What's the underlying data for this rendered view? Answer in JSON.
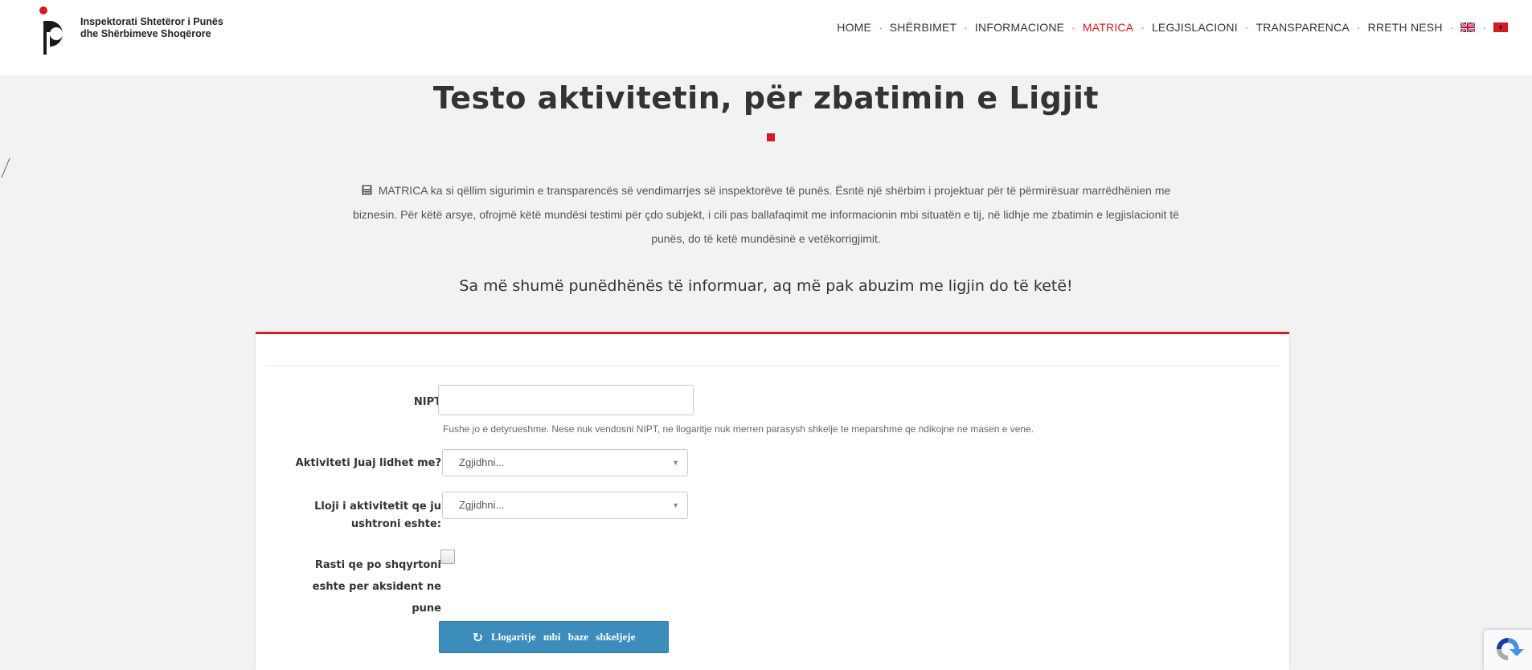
{
  "header": {
    "logo_line1": "Inspektorati Shtetëror i Punës",
    "logo_line2": "dhe Shërbimeve Shoqërore",
    "nav": [
      {
        "label": "HOME"
      },
      {
        "label": "SHËRBIMET"
      },
      {
        "label": "INFORMACIONE"
      },
      {
        "label": "MATRICA"
      },
      {
        "label": "LEGJISLACIONI"
      },
      {
        "label": "TRANSPARENCA"
      },
      {
        "label": "RRETH NESH"
      }
    ],
    "separator": "·",
    "active_item": "MATRICA",
    "icons": [
      "uk-flag-icon",
      "albania-flag-icon"
    ]
  },
  "main": {
    "title": "Testo aktivitetin, për zbatimin e Ligjit",
    "intro_line1": "MATRICA ka si qëllim sigurimin e transparencës së vendimarrjes së inspektorëve të punës. Ësntë një shërbim i projektuar për të përmirësuar marrëdhënien me",
    "intro_line2": "biznesin. Për këtë arsye, ofrojmë këtë mundësi testimi për çdo subjekt, i cili pas ballafaqimit me informacionin mbi situatën e tij, në lidhje me zbatimin e legjislacionit të",
    "intro_line3": "punës, do të ketë mundësinë e vetëkorrigjimit.",
    "tagline": "Sa më shumë punëdhënës të informuar, aq më pak abuzim me ligjin do të ketë!"
  },
  "form": {
    "nipt_label": "NIPT",
    "nipt_value": "",
    "nipt_help": "Fushe jo e detyrueshme. Nese nuk vendosni NIPT, ne llogaritje nuk merren parasysh shkelje te meparshme qe ndikojne ne masen e vene.",
    "activity_label": "Aktiviteti Juaj lidhet me?",
    "activity_selected": "Zgjidhni...",
    "type_label_line1": "Lloji i aktivitetit qe ju",
    "type_label_line2": "ushtroni eshte:",
    "type_selected": "Zgjidhni...",
    "accident_label_line1": "Rasti qe po shqyrtoni",
    "accident_label_line2": "eshte per aksident ne",
    "accident_label_line3": "pune",
    "accident_checked": false,
    "submit_label": "Llogaritje mbi baze shkeljeje"
  },
  "colors": {
    "accent": "#d71920",
    "button": "#3c8dbc",
    "panel_border": "#c9222a"
  }
}
